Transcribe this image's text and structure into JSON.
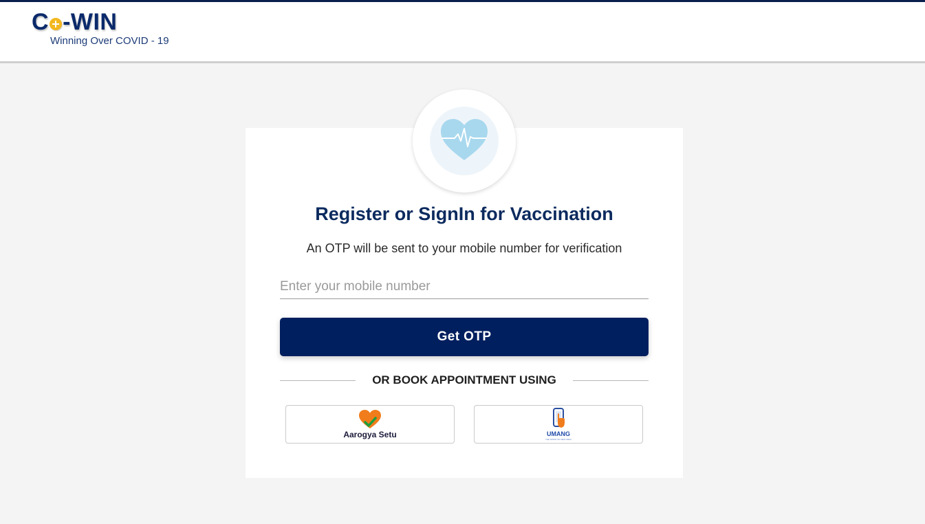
{
  "header": {
    "logo": {
      "name": "Co-WIN",
      "part1": "C",
      "part2": "-WIN",
      "tagline": "Winning Over COVID - 19"
    }
  },
  "login_card": {
    "title": "Register or SignIn for Vaccination",
    "subtitle": "An OTP will be sent to your mobile number for verification",
    "mobile_input": {
      "placeholder": "Enter your mobile number",
      "value": ""
    },
    "get_otp_label": "Get OTP",
    "divider_text": "OR BOOK APPOINTMENT USING",
    "partners": [
      {
        "label": "Aarogya Setu",
        "icon": "aarogya-setu-heart-icon"
      },
      {
        "label": "UMANG",
        "sublabel": "THE SPIRIT OF NEW INDIA",
        "icon": "umang-phone-icon"
      }
    ]
  },
  "colors": {
    "primary": "#001f5f",
    "title": "#0b2a5e",
    "background": "#f4f4f4",
    "logo_accent": "#f3b81f",
    "heart": "#a8d8ee"
  }
}
